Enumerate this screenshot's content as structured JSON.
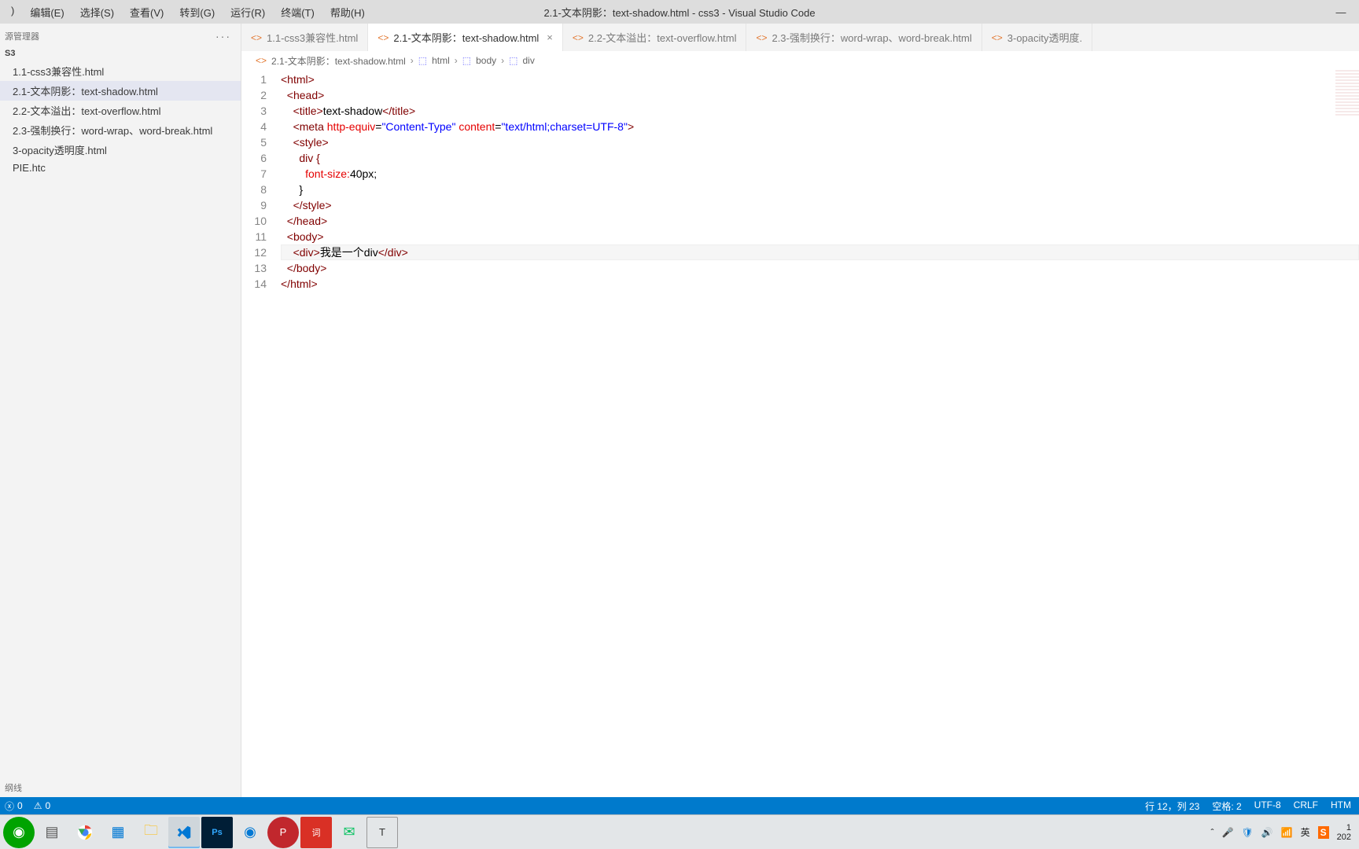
{
  "window": {
    "title": "2.1-文本阴影：text-shadow.html - css3 - Visual Studio Code",
    "minimize": "—"
  },
  "menu": {
    "items": [
      ")",
      "编辑(E)",
      "选择(S)",
      "查看(V)",
      "转到(G)",
      "运行(R)",
      "终端(T)",
      "帮助(H)"
    ]
  },
  "sidebar": {
    "header": "源管理器",
    "dots": "···",
    "section": "S3",
    "files": [
      "1.1-css3兼容性.html",
      "2.1-文本阴影：text-shadow.html",
      "2.2-文本溢出：text-overflow.html",
      "2.3-强制换行：word-wrap、word-break.html",
      "3-opacity透明度.html",
      "PIE.htc"
    ],
    "activeIndex": 1,
    "bottom": "纲线"
  },
  "tabs": {
    "items": [
      {
        "label": "1.1-css3兼容性.html",
        "active": false
      },
      {
        "label": "2.1-文本阴影：text-shadow.html",
        "active": true
      },
      {
        "label": "2.2-文本溢出：text-overflow.html",
        "active": false
      },
      {
        "label": "2.3-强制换行：word-wrap、word-break.html",
        "active": false
      },
      {
        "label": "3-opacity透明度.",
        "active": false
      }
    ]
  },
  "breadcrumb": {
    "file": "2.1-文本阴影：text-shadow.html",
    "path": [
      "html",
      "body",
      "div"
    ]
  },
  "code": {
    "lines": 14,
    "html_tag_open": "<html>",
    "head_open": "<head>",
    "title_line": {
      "open": "<title>",
      "text": "text-shadow",
      "close": "</title>"
    },
    "meta_line": {
      "tag": "<meta ",
      "attr1": "http-equiv",
      "val1": "\"Content-Type\"",
      "attr2": "content",
      "val2": "\"text/html;charset=UTF-8\"",
      "end": ">"
    },
    "style_open": "<style>",
    "rule_sel": "div {",
    "rule_prop": "font-size:",
    "rule_val": "40px",
    "rule_punc": ";",
    "rule_close": "}",
    "style_close": "</style>",
    "head_close": "</head>",
    "body_open": "<body>",
    "div_line": {
      "open": "<div>",
      "text": "我是一个div",
      "close": "</div>"
    },
    "body_close": "</body>",
    "html_close": "</html>"
  },
  "statusbar": {
    "errors": "0",
    "warnings": "0",
    "line_col": "行 12，列 23",
    "spaces": "空格: 2",
    "encoding": "UTF-8",
    "eol": "CRLF",
    "lang": "HTM"
  },
  "tray": {
    "ime1": "英",
    "time": "1",
    "date": "202"
  }
}
